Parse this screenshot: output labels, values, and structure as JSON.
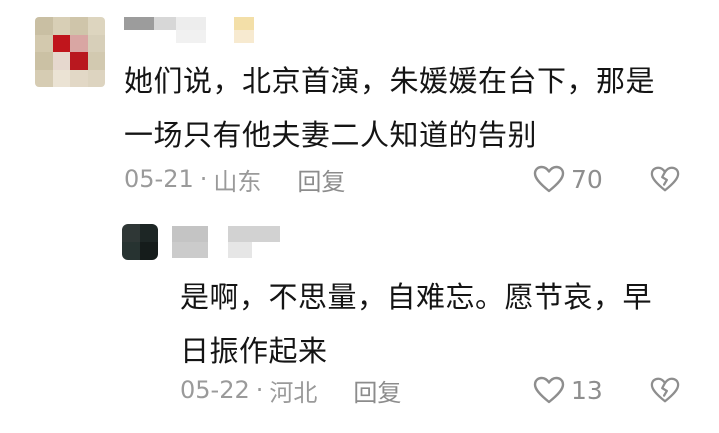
{
  "comments": [
    {
      "text_lines": [
        "她们说，北京首演，朱媛媛在台下，那是",
        "一场只有他夫妻二人知道的告别"
      ],
      "date": "05-21",
      "separator": "·",
      "location": "山东",
      "reply_label": "回复",
      "like_count": "70"
    },
    {
      "text_lines": [
        "是啊，不思量，自难忘。愿节哀，早",
        "日振作起来"
      ],
      "date": "05-22",
      "separator": "·",
      "location": "河北",
      "reply_label": "回复",
      "like_count": "13"
    }
  ],
  "colors": {
    "text": "#141414",
    "meta": "#9a9a9a",
    "icon": "#8e8e8e",
    "avatar_red": "#c0151c"
  },
  "icons": {
    "like": "heart-outline-icon",
    "dislike": "broken-heart-icon"
  }
}
